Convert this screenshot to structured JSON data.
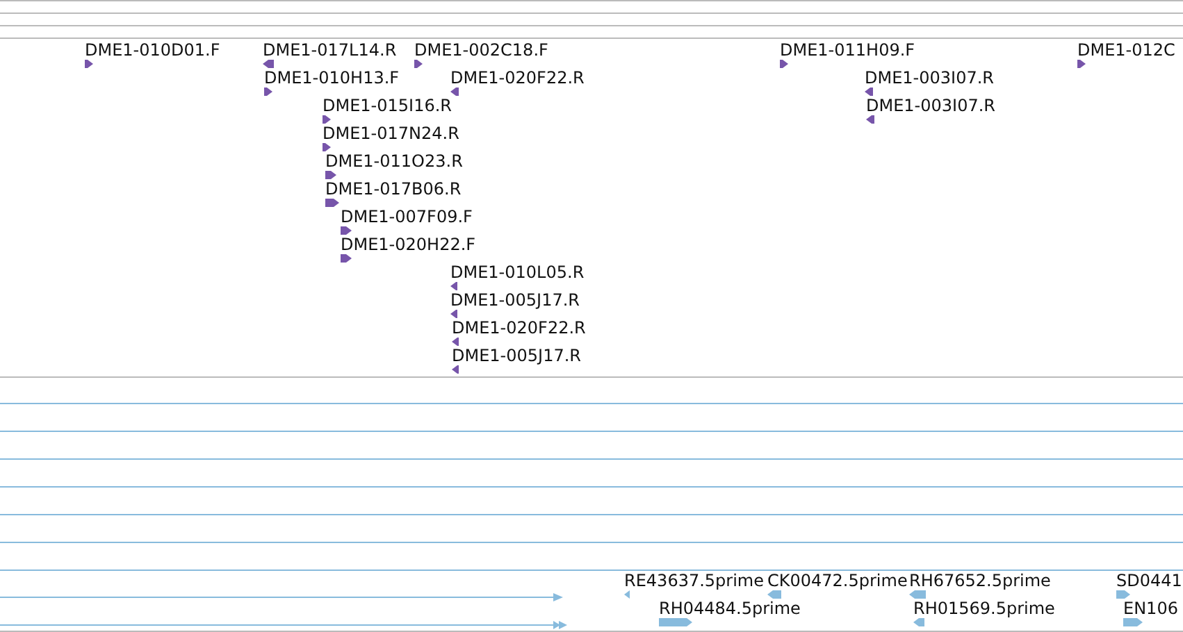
{
  "tracks": [
    {
      "kind": "clones",
      "features": [
        {
          "label": "DME1-010D01.F",
          "reverse": false
        },
        {
          "label": "DME1-017L14.R",
          "reverse": true
        },
        {
          "label": "DME1-002C18.F",
          "reverse": false
        },
        {
          "label": "DME1-010H13.F",
          "reverse": false
        },
        {
          "label": "DME1-020F22.R",
          "reverse": true
        },
        {
          "label": "DME1-015I16.R",
          "reverse": false
        },
        {
          "label": "DME1-017N24.R",
          "reverse": false
        },
        {
          "label": "DME1-011O23.R",
          "reverse": false
        },
        {
          "label": "DME1-017B06.R",
          "reverse": false
        },
        {
          "label": "DME1-007F09.F",
          "reverse": false
        },
        {
          "label": "DME1-020H22.F",
          "reverse": false
        },
        {
          "label": "DME1-010L05.R",
          "reverse": true
        },
        {
          "label": "DME1-005J17.R",
          "reverse": true
        },
        {
          "label": "DME1-020F22.R",
          "reverse": true
        },
        {
          "label": "DME1-005J17.R",
          "reverse": true
        },
        {
          "label": "DME1-011H09.F",
          "reverse": false
        },
        {
          "label": "DME1-003I07.R",
          "reverse": true
        },
        {
          "label": "DME1-003I07.R",
          "reverse": true
        },
        {
          "label": "DME1-012C",
          "reverse": false
        }
      ]
    },
    {
      "kind": "ests",
      "features": [
        {
          "label": "RE43637.5prime",
          "reverse": true
        },
        {
          "label": "CK00472.5prime",
          "reverse": true
        },
        {
          "label": "RH67652.5prime",
          "reverse": true
        },
        {
          "label": "SD0441",
          "reverse": false
        },
        {
          "label": "RH04484.5prime",
          "reverse": false
        },
        {
          "label": "RH01569.5prime",
          "reverse": true
        },
        {
          "label": "EN106",
          "reverse": false
        }
      ]
    }
  ]
}
